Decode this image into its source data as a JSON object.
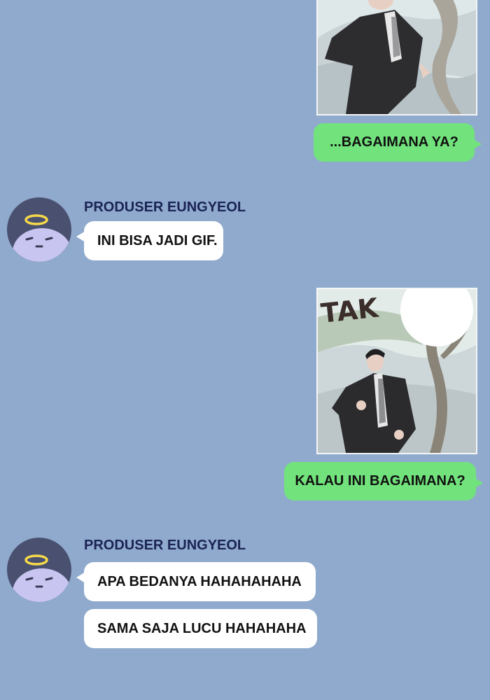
{
  "messages": [
    {
      "type": "image",
      "direction": "out",
      "description_icon": "photo-man-falling"
    },
    {
      "type": "text",
      "direction": "out",
      "text": "...BAGAIMANA YA?"
    },
    {
      "type": "text",
      "direction": "in",
      "sender": "PRODUSER EUNGYEOL",
      "text": "INI BISA JADI GIF."
    },
    {
      "type": "image",
      "direction": "out",
      "description_icon": "photo-man-running",
      "sfx": "TAK"
    },
    {
      "type": "text",
      "direction": "out",
      "text": "KALAU INI BAGAIMANA?"
    },
    {
      "type": "text",
      "direction": "in",
      "sender": "PRODUSER EUNGYEOL",
      "text": "APA BEDANYA HAHAHAHAHA"
    },
    {
      "type": "text",
      "direction": "in",
      "text": "SAMA SAJA LUCU HAHAHAHA"
    }
  ],
  "colors": {
    "background": "#8faacd",
    "outgoing_bubble": "#72e37c",
    "incoming_bubble": "#ffffff",
    "sender_name": "#1b2454",
    "avatar": "#4a5070"
  }
}
